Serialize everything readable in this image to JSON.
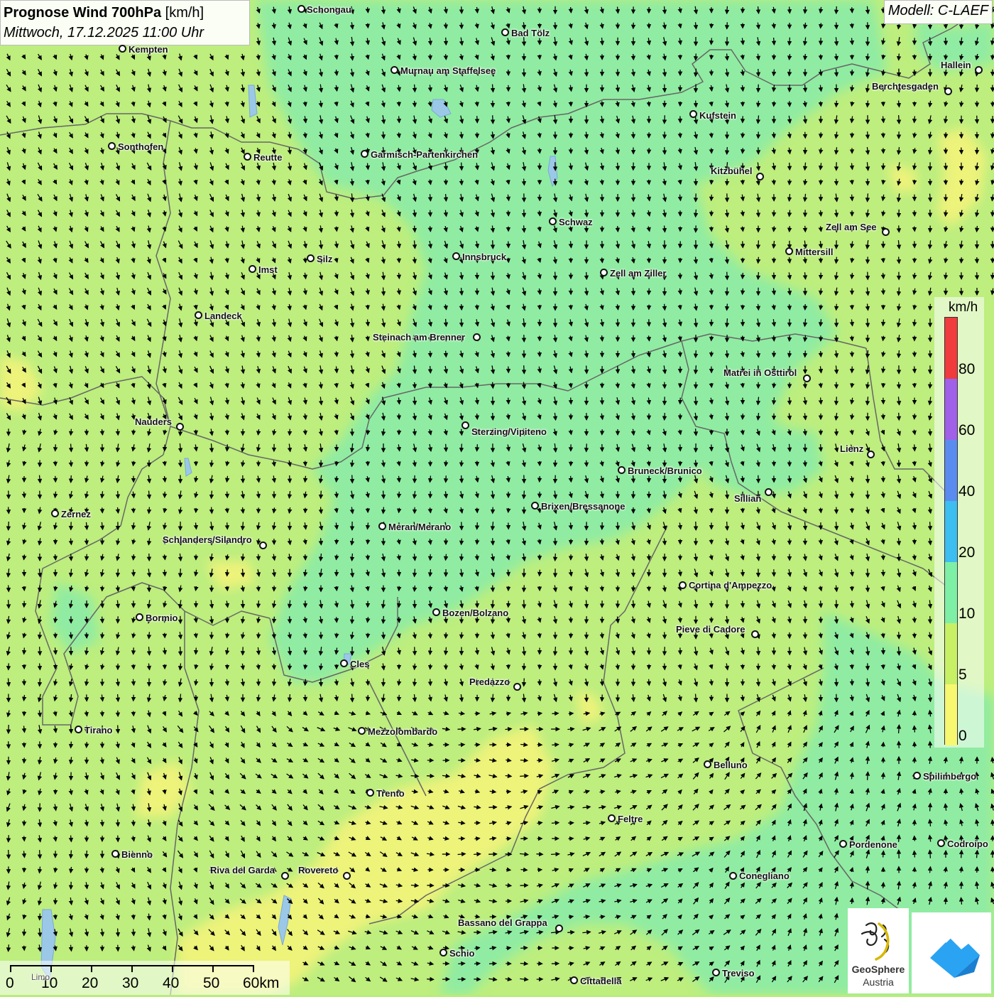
{
  "title": {
    "main": "Prognose Wind 700hPa",
    "unit": "[km/h]",
    "date": "Mittwoch, 17.12.2025 11:00 Uhr"
  },
  "model": "Modell: C-LAEF",
  "legend": {
    "unit": "km/h",
    "labels": [
      "80",
      "60",
      "40",
      "20",
      "10",
      "5",
      "0"
    ],
    "colors": [
      "#f03c3c",
      "#a060e8",
      "#5a8cf0",
      "#3cbef0",
      "#7ef0a6",
      "#c8f064",
      "#f8f870"
    ]
  },
  "scalebar": {
    "labels": [
      "0",
      "10",
      "20",
      "30",
      "40",
      "50",
      "60km"
    ],
    "city_overlap": "Limo"
  },
  "colors": {
    "speed_0_5": "#eef37a",
    "speed_5_10": "#bdee7e",
    "speed_10_20": "#90eca2",
    "border_lines": "#666666",
    "arrows": "#000000"
  },
  "cities": [
    {
      "name": "Schongau"
    },
    {
      "name": "Bad Tölz"
    },
    {
      "name": "Kempten"
    },
    {
      "name": "Murnau am Staffelsee"
    },
    {
      "name": "Hallein"
    },
    {
      "name": "Berchtesgaden"
    },
    {
      "name": "Kufstein"
    },
    {
      "name": "Sonthofen"
    },
    {
      "name": "Reutte"
    },
    {
      "name": "Garmisch-Partenkirchen"
    },
    {
      "name": "Kitzbühel"
    },
    {
      "name": "Schwaz"
    },
    {
      "name": "Zell am See"
    },
    {
      "name": "Innsbruck"
    },
    {
      "name": "Mittersill"
    },
    {
      "name": "Silz"
    },
    {
      "name": "Imst"
    },
    {
      "name": "Zell am Ziller"
    },
    {
      "name": "Landeck"
    },
    {
      "name": "Steinach am Brenner"
    },
    {
      "name": "Matrei in Osttirol"
    },
    {
      "name": "Nauders"
    },
    {
      "name": "Sterzing/Vipiteno"
    },
    {
      "name": "Lienz"
    },
    {
      "name": "Bruneck/Brunico"
    },
    {
      "name": "Sillian"
    },
    {
      "name": "Brixen/Bressanone"
    },
    {
      "name": "Zernez"
    },
    {
      "name": "Meran/Merano"
    },
    {
      "name": "Schlanders/Silandro"
    },
    {
      "name": "Cortina d'Ampezzo"
    },
    {
      "name": "Bozen/Bolzano"
    },
    {
      "name": "Bormio"
    },
    {
      "name": "Pieve di Cadore"
    },
    {
      "name": "Cles"
    },
    {
      "name": "Predazzo"
    },
    {
      "name": "Tirano"
    },
    {
      "name": "Mezzolombardo"
    },
    {
      "name": "Belluno"
    },
    {
      "name": "Spilimbergo"
    },
    {
      "name": "Trento"
    },
    {
      "name": "Feltre"
    },
    {
      "name": "Pordenone"
    },
    {
      "name": "Codroipo"
    },
    {
      "name": "Bienno"
    },
    {
      "name": "Riva del Garda"
    },
    {
      "name": "Rovereto"
    },
    {
      "name": "Conegliano"
    },
    {
      "name": "Bassano del Grappa"
    },
    {
      "name": "Schio"
    },
    {
      "name": "Treviso"
    },
    {
      "name": "Cittadella"
    }
  ],
  "logo": {
    "name_line1": "GeoSphere",
    "name_line2": "Austria"
  }
}
